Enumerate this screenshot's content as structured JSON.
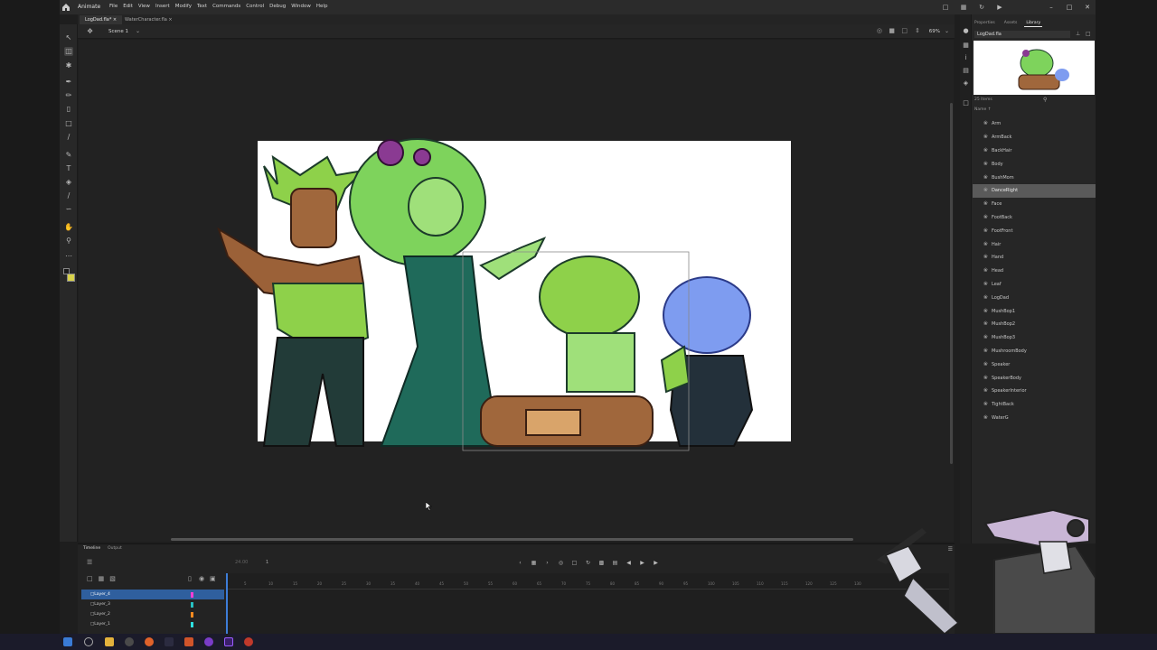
{
  "app": {
    "name": "Animate",
    "menu": [
      "File",
      "Edit",
      "View",
      "Insert",
      "Modify",
      "Text",
      "Commands",
      "Control",
      "Debug",
      "Window",
      "Help"
    ]
  },
  "documents": {
    "tabs": [
      "LogDad.fla*",
      "WaterCharacter.fla"
    ]
  },
  "scene": {
    "label": "Scene 1",
    "zoom": "69%"
  },
  "library": {
    "tabs": [
      "Properties",
      "Assets",
      "Library"
    ],
    "document": "LogDad.fla",
    "count": "25 Items",
    "name_header": "Name",
    "selected_index": 5,
    "items": [
      "Arm",
      "ArmBack",
      "BackHair",
      "Body",
      "BushMom",
      "DanceRight",
      "Face",
      "FootBack",
      "FootFront",
      "Hair",
      "Hand",
      "Head",
      "Leaf",
      "LogDad",
      "MushBop1",
      "MushBop2",
      "MushBop3",
      "MushroomBody",
      "Speaker",
      "SpeakerBody",
      "SpeakerInterior",
      "TightBack",
      "WaterG"
    ]
  },
  "timeline": {
    "tabs": [
      "Timeline",
      "Output"
    ],
    "fps": "24.00",
    "frame": "1",
    "layers": [
      {
        "name": "Layer_4",
        "color": "#ff3dd6",
        "selected": true
      },
      {
        "name": "Layer_3",
        "color": "#27c2c2",
        "selected": false
      },
      {
        "name": "Layer_2",
        "color": "#ff8a1f",
        "selected": false
      },
      {
        "name": "Layer_1",
        "color": "#2ee0e0",
        "selected": false
      }
    ],
    "ruler": [
      "5",
      "10",
      "15",
      "20",
      "25",
      "30",
      "35",
      "40",
      "45",
      "50",
      "55",
      "60",
      "65",
      "70",
      "75",
      "80",
      "85",
      "90",
      "95",
      "100",
      "105",
      "110",
      "115",
      "120",
      "125",
      "130"
    ]
  },
  "colors": {
    "accent": "#3d7dd8",
    "stage": "#ffffff",
    "app_bg": "#1e1e1e"
  }
}
